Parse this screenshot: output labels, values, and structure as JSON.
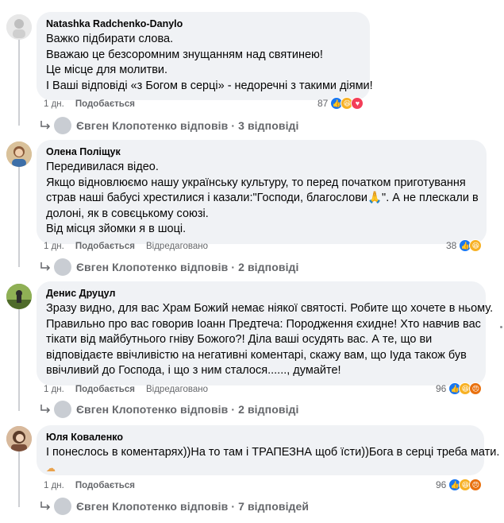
{
  "comments": [
    {
      "author": "Natashka Radchenko-Danylo",
      "lines": [
        "Важко підбирати слова.",
        "Вважаю це безсоромним знущанням над святинею!",
        "Це місце для молитви.",
        "І Ваші відповіді «з Богом в серці» - недоречні з такими діями!"
      ],
      "time": "1 дн.",
      "like": "Подобається",
      "reply": "",
      "reaction_count": "87",
      "replies_text": "Євген Клопотенко відповів · 3 відповіді"
    },
    {
      "author": "Олена Поліщук",
      "lines": [
        "Передивилася відео.",
        "Якщо відновлюємо нашу українську культуру, то перед початком приготування",
        "страв наші бабусі хрестилися і казали:\"Господи, благослови🙏\". А не плескали в",
        "долоні, як в совєцькому союзі.",
        "Від місця зйомки я в шоці."
      ],
      "time": "1 дн.",
      "like": "Подобається",
      "reply": "Відредаговано",
      "reaction_count": "38",
      "replies_text": "Євген Клопотенко відповів · 2 відповіді"
    },
    {
      "author": "Денис Друцул",
      "lines": [
        "Зразу видно, для вас Храм Божий немає ніякої святості. Робите що хочете в ньому.",
        "Правильно про вас говорив Іоанн Предтеча: Породження єхидне! Хто навчив вас",
        "тікати від майбутнього гніву Божого?! Ділa ваші осудять вас. А те, що ви",
        "відповідаєте ввічливістю на негативні коментарі, скажу вам, що Іуда також був",
        "ввічливий до Господа, і що з ним сталося......, думайте!"
      ],
      "time": "1 дн.",
      "like": "Подобається",
      "reply": "Відредаговано",
      "reaction_count": "96",
      "replies_text": "Євген Клопотенко відповів · 2 відповіді"
    },
    {
      "author": "Юля Коваленко",
      "lines": [
        "І понеслось в коментарях))На то там і ТРАПЕЗНА щоб їсти))Бога в серці треба мати."
      ],
      "time": "1 дн.",
      "like": "Подобається",
      "reply": "",
      "reaction_count": "96",
      "replies_text": "Євген Клопотенко відповів · 7 відповідей"
    }
  ],
  "colors": {
    "bubble": "#f0f2f5",
    "meta": "#65676b",
    "like": "#1877f2",
    "love": "#f33e58",
    "haha": "#f7b125"
  }
}
